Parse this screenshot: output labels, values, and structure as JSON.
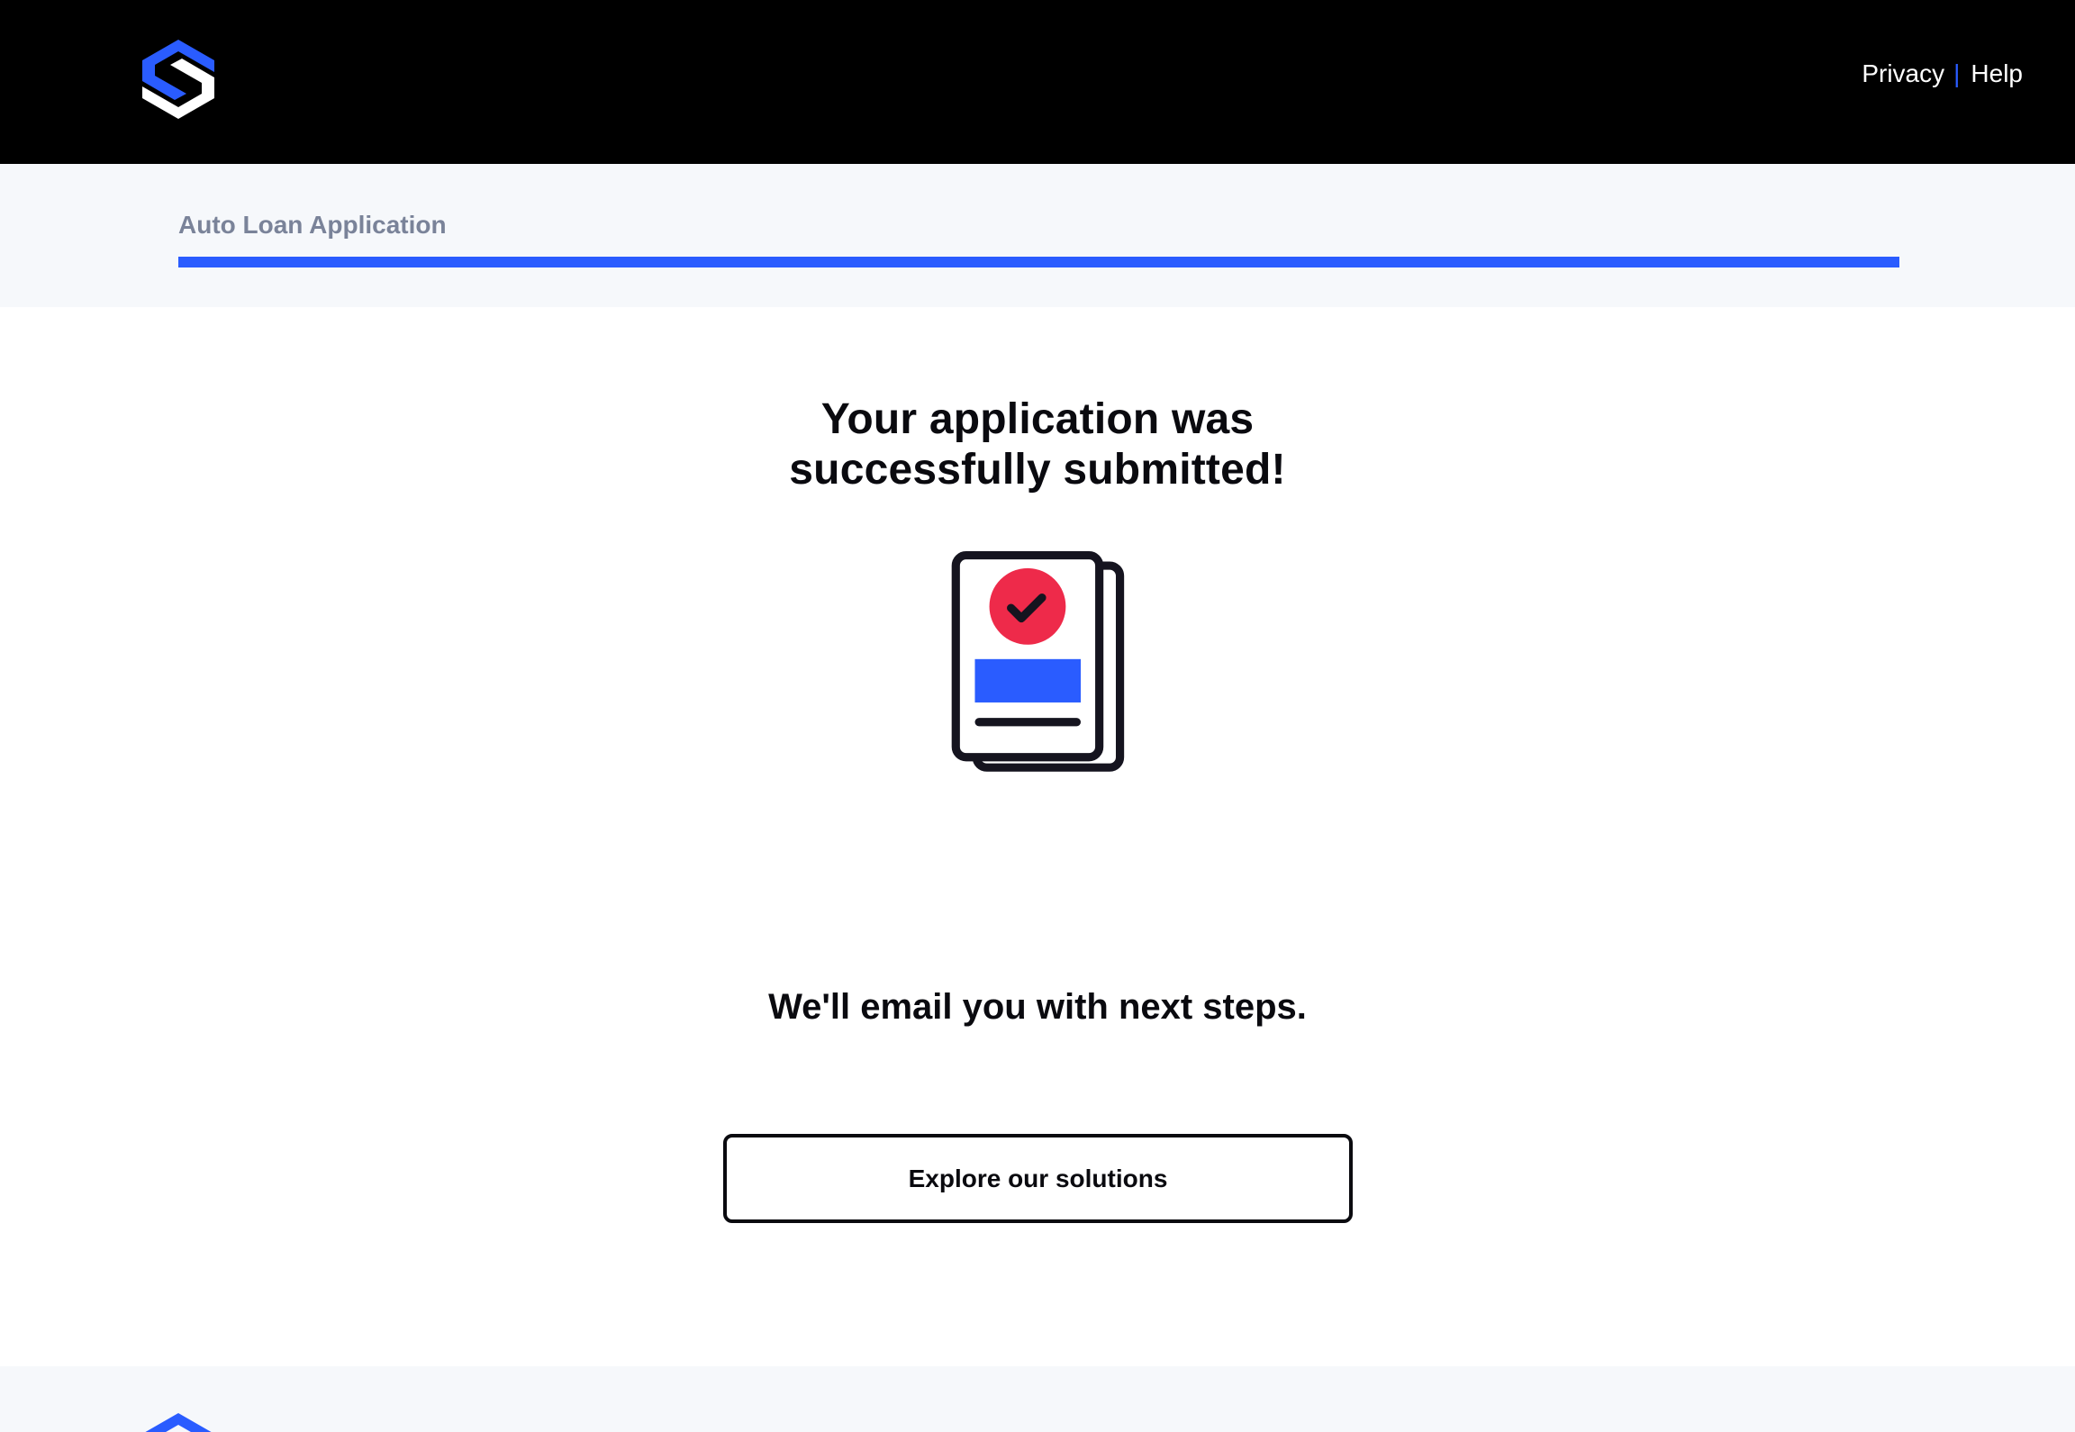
{
  "header": {
    "logo_icon": "s-hexagon-logo-icon",
    "links": [
      {
        "label": "Privacy"
      },
      {
        "label": "Help"
      }
    ],
    "separator": "|"
  },
  "progress": {
    "title": "Auto Loan Application",
    "percent": 100
  },
  "main": {
    "headline_line1": "Your application was",
    "headline_line2": "successfully submitted!",
    "illustration_icon": "submitted-document-check-icon",
    "subline": "We'll email you with next steps.",
    "cta_label": "Explore our solutions"
  },
  "footer": {
    "logo_icon": "s-hexagon-logo-icon"
  },
  "colors": {
    "brand_blue": "#2a5cff",
    "accent_red": "#ee2a4a",
    "header_bg": "#000000",
    "ink": "#0a0a0f"
  }
}
